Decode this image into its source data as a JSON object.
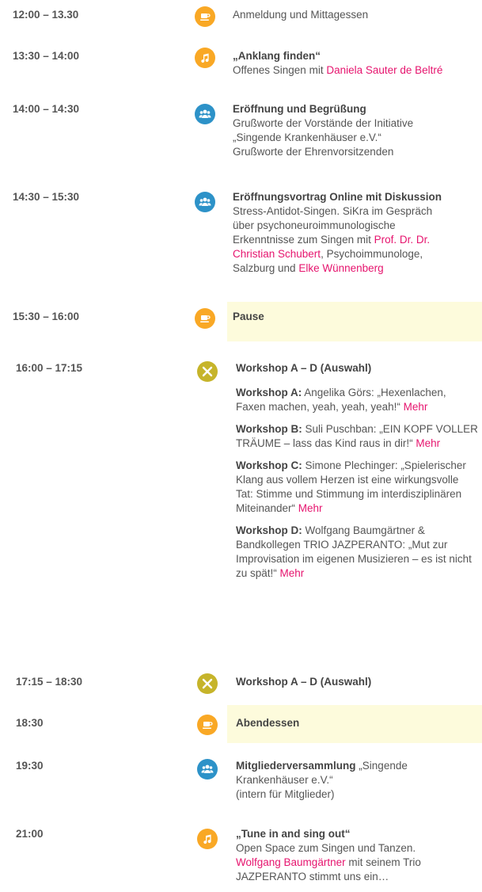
{
  "schedule": [
    {
      "time": "12:00 – 13.30",
      "icon": "coffee-cup-icon",
      "lines": [
        "Anmeldung und Mittagessen"
      ]
    },
    {
      "time": "13:30 – 14:00",
      "icon": "music-note-icon",
      "title": "„Anklang finden“",
      "line1_prefix": "Offenes Singen mit ",
      "line1_link": "Daniela Sauter de Beltré"
    },
    {
      "time": "14:00 – 14:30",
      "icon": "group-icon",
      "title": "Eröffnung und Begrüßung",
      "lines": [
        "Grußworte der Vorstände der Initiative",
        "„Singende Krankenhäuser e.V.“",
        "Grußworte der Ehrenvorsitzenden"
      ]
    },
    {
      "time": "14:30 – 15:30",
      "icon": "group-icon",
      "title": "Eröffnungsvortrag Online mit Diskussion",
      "lines": [
        "Stress-Antidot-Singen. SiKra im Gespräch",
        "über psychoneuroimmunologische",
        "Erkenntnisse zum Singen mit "
      ],
      "link1": "Prof. Dr. Dr.",
      "link2": "Christian Schubert",
      "after_link2": ", Psychoimmunologe,",
      "line_last_prefix": "Salzburg und ",
      "link3": "Elke Wünnenberg"
    },
    {
      "time": "15:30 – 16:00",
      "icon": "coffee-cup-icon",
      "title": "Pause"
    },
    {
      "time": "16:00 – 17:15",
      "icon": "tools-icon",
      "title": "Workshop A – D (Auswahl)",
      "workshops": [
        {
          "label": "Workshop A:",
          "text": " Angelika Görs: „Hexenlachen, Faxen machen, yeah, yeah, yeah!“ ",
          "more": "Mehr"
        },
        {
          "label": "Workshop B:",
          "text": " Suli Puschban: „EIN KOPF VOLLER TRÄUME – lass das Kind raus in dir!“ ",
          "more": "Mehr"
        },
        {
          "label": "Workshop C:",
          "text": " Simone Plechinger: „Spielerischer Klang aus vollem Herzen ist eine wirkungsvolle Tat: Stimme und Stimmung im interdisziplinären Miteinander“ ",
          "more": "Mehr"
        },
        {
          "label": "Workshop D:",
          "text": " Wolfgang Baumgärtner & Bandkollegen TRIO JAZPERANTO: „Mut zur Improvisation im eigenen Musizieren – es ist nicht zu spät!“ ",
          "more": "Mehr"
        }
      ]
    },
    {
      "time": "17:15 – 18:30",
      "icon": "tools-icon",
      "title": "Workshop A – D (Auswahl)"
    },
    {
      "time": "18:30",
      "icon": "coffee-cup-icon",
      "title": "Abendessen"
    },
    {
      "time": "19:30",
      "icon": "group-icon",
      "title": "Mitgliederversammlung",
      "title_rest": " „Singende",
      "lines": [
        "Krankenhäuser e.V.“",
        "(intern für Mitglieder)"
      ]
    },
    {
      "time": "21:00",
      "icon": "music-note-icon",
      "title": "„Tune in and sing out“",
      "lines": [
        "Open Space zum Singen und Tanzen."
      ],
      "link": "Wolfgang Baumgärtner",
      "after_link": " mit seinem Trio",
      "last_line": "JAZPERANTO stimmt uns ein…"
    }
  ],
  "colors": {
    "orange": "#f9a825",
    "blue": "#2d92c8",
    "olive": "#c6b42a",
    "link": "#e6146e",
    "highlight": "#fdfbdc"
  }
}
